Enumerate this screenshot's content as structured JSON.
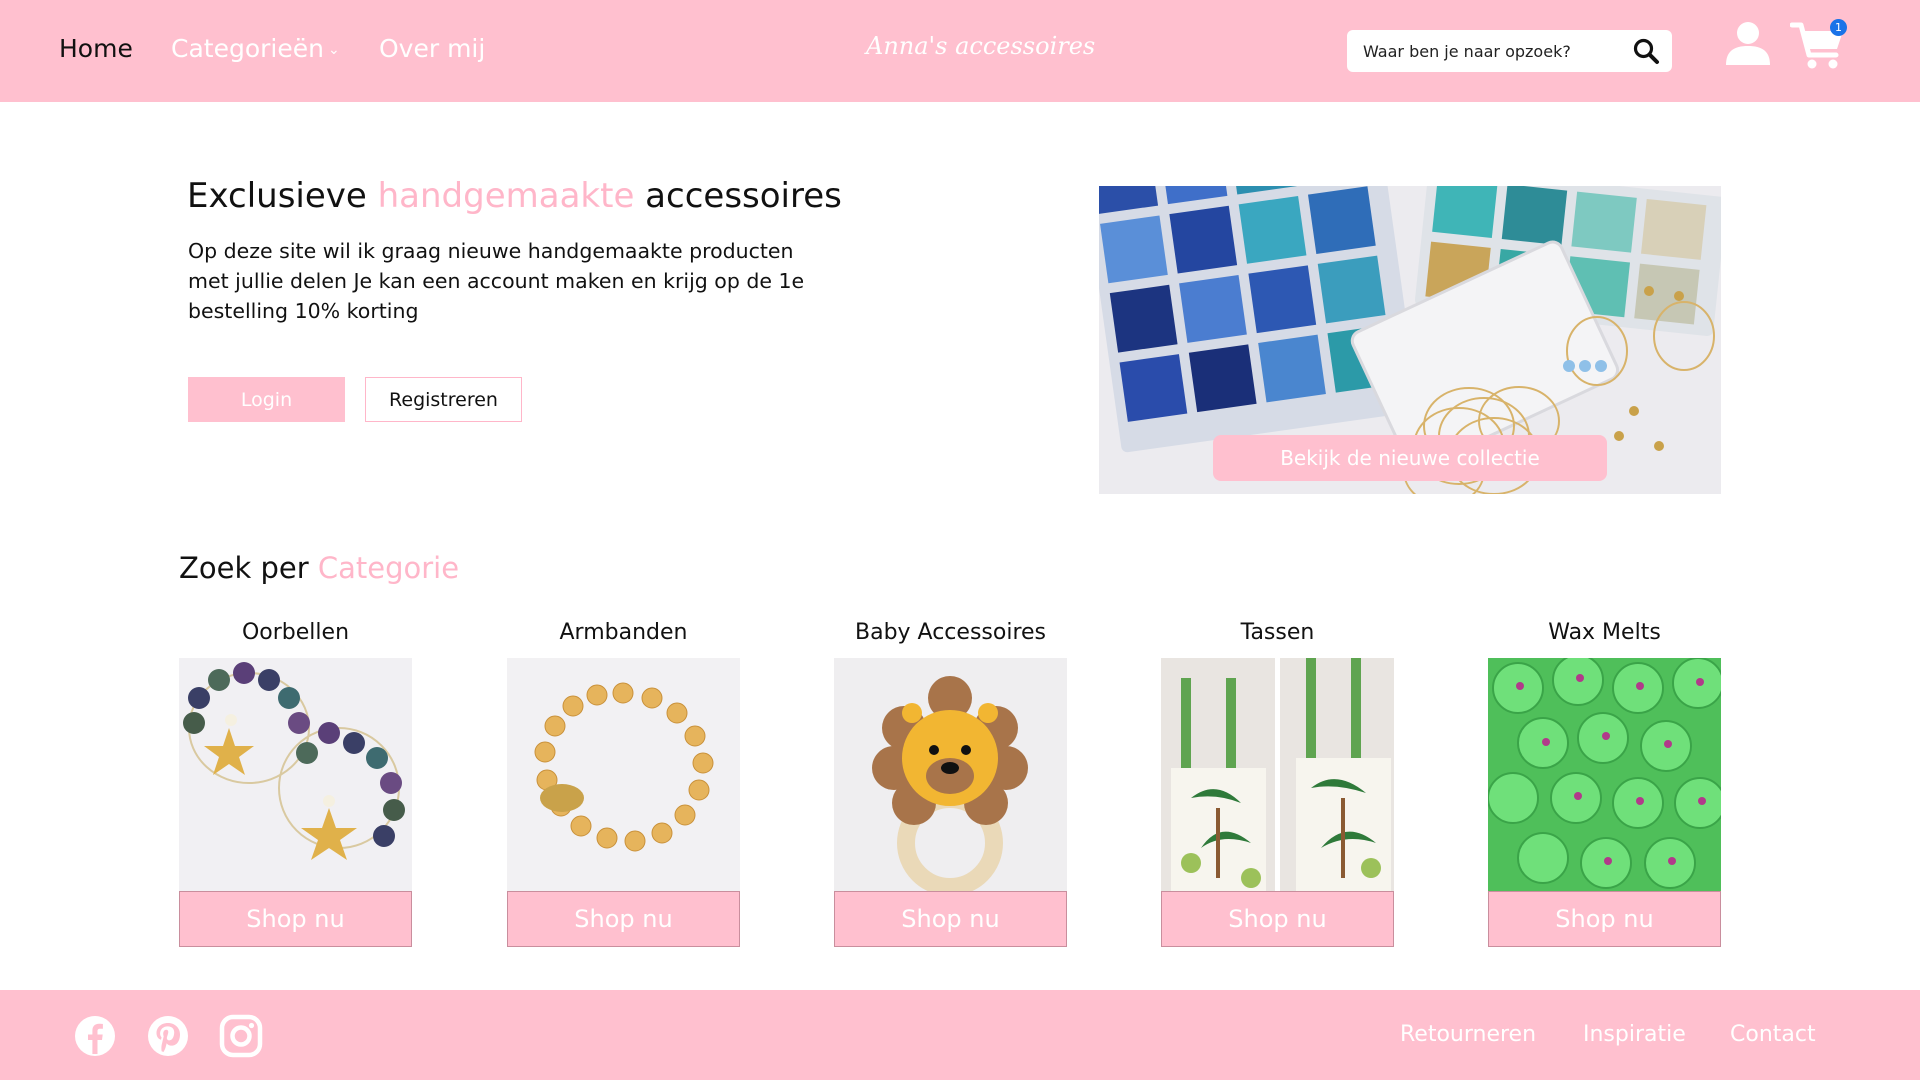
{
  "header": {
    "nav": [
      {
        "label": "Home"
      },
      {
        "label": "Categorieën"
      },
      {
        "label": "Over mij"
      }
    ],
    "brand": "Anna's accessoires",
    "search_placeholder": "Waar ben je naar opzoek?",
    "cart_count": "1",
    "icons": [
      "chevron-down-icon",
      "search-icon",
      "user-icon",
      "cart-icon"
    ]
  },
  "hero": {
    "title_part1": "Exclusieve ",
    "title_accent": "handgemaakte",
    "title_part2": " accessoires",
    "text": "Op deze site wil ik graag nieuwe handgemaakte producten met jullie delen Je kan een account maken en krijg op de 1e bestelling 10% korting",
    "login_label": "Login",
    "register_label": "Registreren",
    "collection_label": "Bekijk de nieuwe collectie"
  },
  "categories": {
    "heading_part1": "Zoek per ",
    "heading_accent": "Categorie",
    "items": [
      {
        "label": "Oorbellen",
        "button": "Shop nu"
      },
      {
        "label": "Armbanden",
        "button": "Shop nu"
      },
      {
        "label": "Baby Accessoires",
        "button": "Shop nu"
      },
      {
        "label": "Tassen",
        "button": "Shop nu"
      },
      {
        "label": "Wax Melts",
        "button": "Shop nu"
      }
    ]
  },
  "footer": {
    "social": [
      "facebook-icon",
      "pinterest-icon",
      "instagram-icon"
    ],
    "links": [
      {
        "label": "Retourneren"
      },
      {
        "label": "Inspiratie"
      },
      {
        "label": "Contact"
      }
    ]
  },
  "colors": {
    "brand_pink": "#ffc0cf",
    "accent_pink": "#ffb6c9",
    "badge_blue": "#1a73e8"
  }
}
